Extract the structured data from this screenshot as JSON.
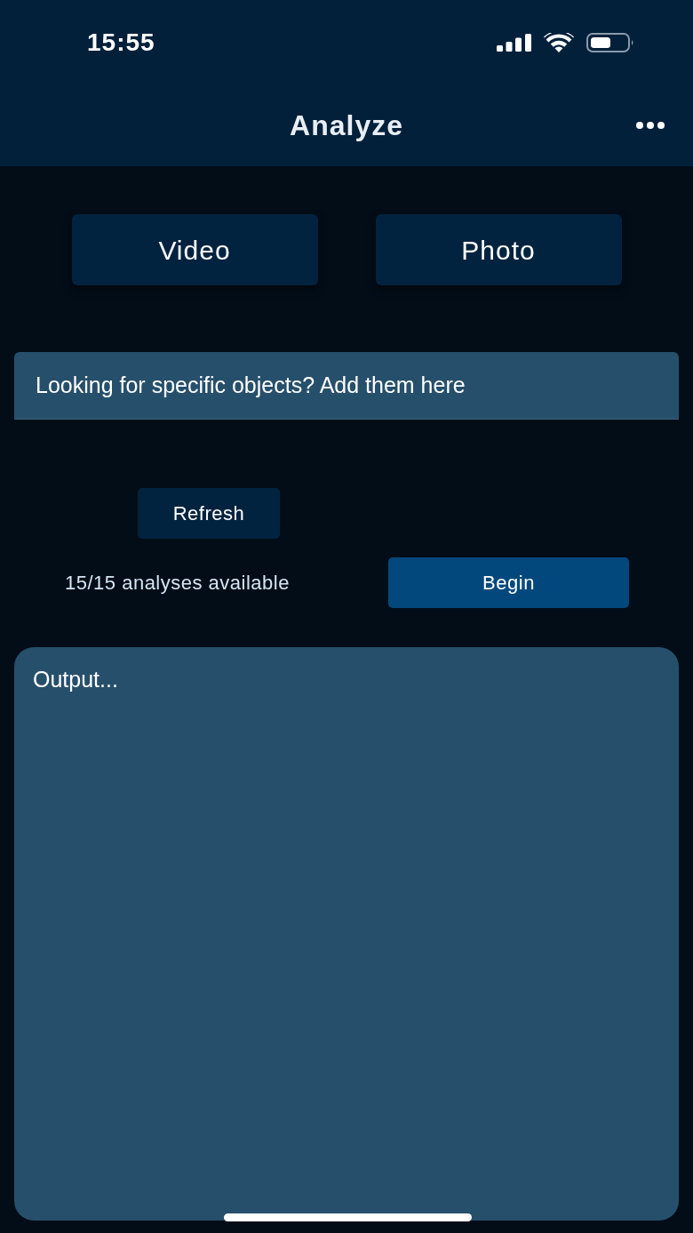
{
  "status_bar": {
    "time": "15:55"
  },
  "header": {
    "title": "Analyze"
  },
  "mode_buttons": [
    {
      "label": "Video"
    },
    {
      "label": "Photo"
    }
  ],
  "objects_field": {
    "placeholder": "Looking for specific objects? Add them here"
  },
  "refresh_button": {
    "label": "Refresh"
  },
  "analyses_count": "15/15 analyses available",
  "begin_button": {
    "label": "Begin"
  },
  "output": {
    "placeholder": "Output..."
  }
}
